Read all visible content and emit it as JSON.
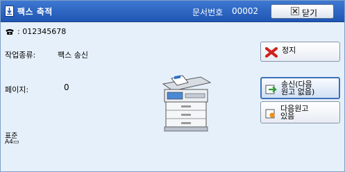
{
  "header": {
    "title": "팩스 축적",
    "job_number_label": "문서번호",
    "job_number": "00002",
    "close_label": "닫기"
  },
  "info": {
    "fax_number": ": 012345678",
    "job_type_label": "작업종류:",
    "job_type_value": "팩스 송신",
    "pages_label": "페이지:",
    "pages_value": "0",
    "resolution": "표준",
    "paper_size": "A4▭"
  },
  "buttons": {
    "stop_label": "정지",
    "send_label_line1": "송신(다음",
    "send_label_line2": "원고 없음)",
    "next_label_line1": "다음원고",
    "next_label_line2": "있음"
  },
  "colors": {
    "titlebar": "#2a63c4",
    "panel_bg": "#e6f0fa",
    "stop_x": "#d0221c",
    "selected_border": "#3d6fb8"
  },
  "icons": {
    "title": "fax-store-icon",
    "fax": "telephone-icon",
    "close": "close-x-icon",
    "stop": "red-x-icon",
    "send": "send-arrow-icon",
    "next": "next-original-icon",
    "machine": "multifunction-printer-icon"
  }
}
